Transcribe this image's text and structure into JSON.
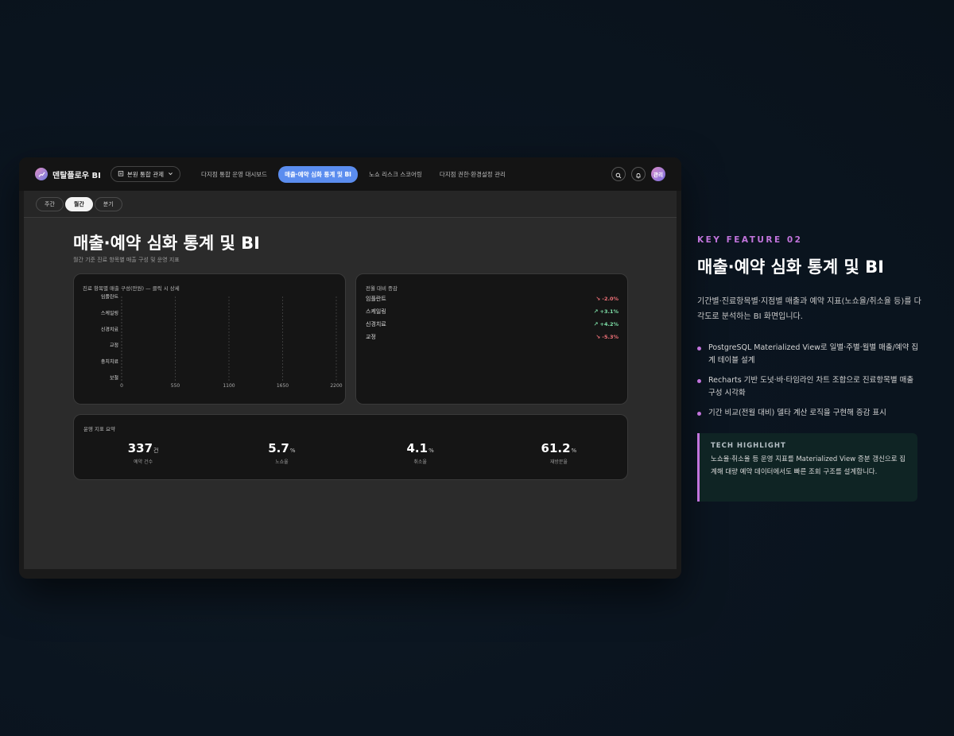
{
  "app": {
    "brand": "덴탈플로우 BI",
    "branch_selector": "본원 통합 관제",
    "nav": [
      {
        "label": "다지점 통합 운영 대시보드",
        "active": false
      },
      {
        "label": "매출·예약 심화 통계 및 BI",
        "active": true
      },
      {
        "label": "노쇼 리스크 스코어링",
        "active": false
      },
      {
        "label": "다지점 권한·환경설정 관리",
        "active": false
      }
    ],
    "avatar_label": "관리",
    "accent_color": "#5b8def"
  },
  "period_tabs": [
    {
      "label": "주간",
      "active": false
    },
    {
      "label": "월간",
      "active": true
    },
    {
      "label": "분기",
      "active": false
    }
  ],
  "page": {
    "title": "매출·예약 심화 통계 및 BI",
    "subtitle": "월간 기준 진료 항목별 매출 구성 및 운영 지표"
  },
  "chart_data": {
    "type": "bar",
    "title": "진료 항목별 매출 구성(만원) — 클릭 시 상세",
    "orientation": "horizontal",
    "categories": [
      "임플란트",
      "스케일링",
      "신경치료",
      "교정",
      "충치치료",
      "보철"
    ],
    "values": [
      0,
      0,
      0,
      0,
      0,
      0
    ],
    "xticks": [
      0,
      550,
      1100,
      1650,
      2200
    ],
    "xlim": [
      0,
      2200
    ],
    "grid": true
  },
  "delta_card": {
    "title": "전월 대비 증감",
    "rows": [
      {
        "name": "임플란트",
        "value": "-2.0%",
        "direction": "down"
      },
      {
        "name": "스케일링",
        "value": "+3.1%",
        "direction": "up"
      },
      {
        "name": "신경치료",
        "value": "+4.2%",
        "direction": "up"
      },
      {
        "name": "교정",
        "value": "-5.3%",
        "direction": "down"
      }
    ],
    "up_color": "#7ee0a8",
    "down_color": "#f07178"
  },
  "ops_card": {
    "title": "운영 지표 요약",
    "stats": [
      {
        "value": "337",
        "unit": "건",
        "label": "예약 건수"
      },
      {
        "value": "5.7",
        "unit": "%",
        "label": "노쇼율"
      },
      {
        "value": "4.1",
        "unit": "%",
        "label": "취소율"
      },
      {
        "value": "61.2",
        "unit": "%",
        "label": "재방문율"
      }
    ]
  },
  "side": {
    "kicker": "KEY FEATURE 02",
    "title": "매출·예약 심화 통계 및 BI",
    "description": "기간별·진료항목별·지점별 매출과 예약 지표(노쇼율/취소율 등)를 다각도로 분석하는 BI 화면입니다.",
    "bullets": [
      "PostgreSQL Materialized View로 일별·주별·월별 매출/예약 집계 테이블 설계",
      "Recharts 기반 도넛·바·타임라인 차트 조합으로 진료항목별 매출 구성 시각화",
      "기간 비교(전월 대비) 델타 계산 로직을 구현해 증감 표시"
    ],
    "highlight_title": "TECH HIGHLIGHT",
    "highlight_text": "노쇼율·취소율 등 운영 지표를 Materialized View 증분 갱신으로 집계해 대량 예약 데이터에서도 빠른 조회 구조를 설계합니다.",
    "accent_color": "#c274dc"
  }
}
